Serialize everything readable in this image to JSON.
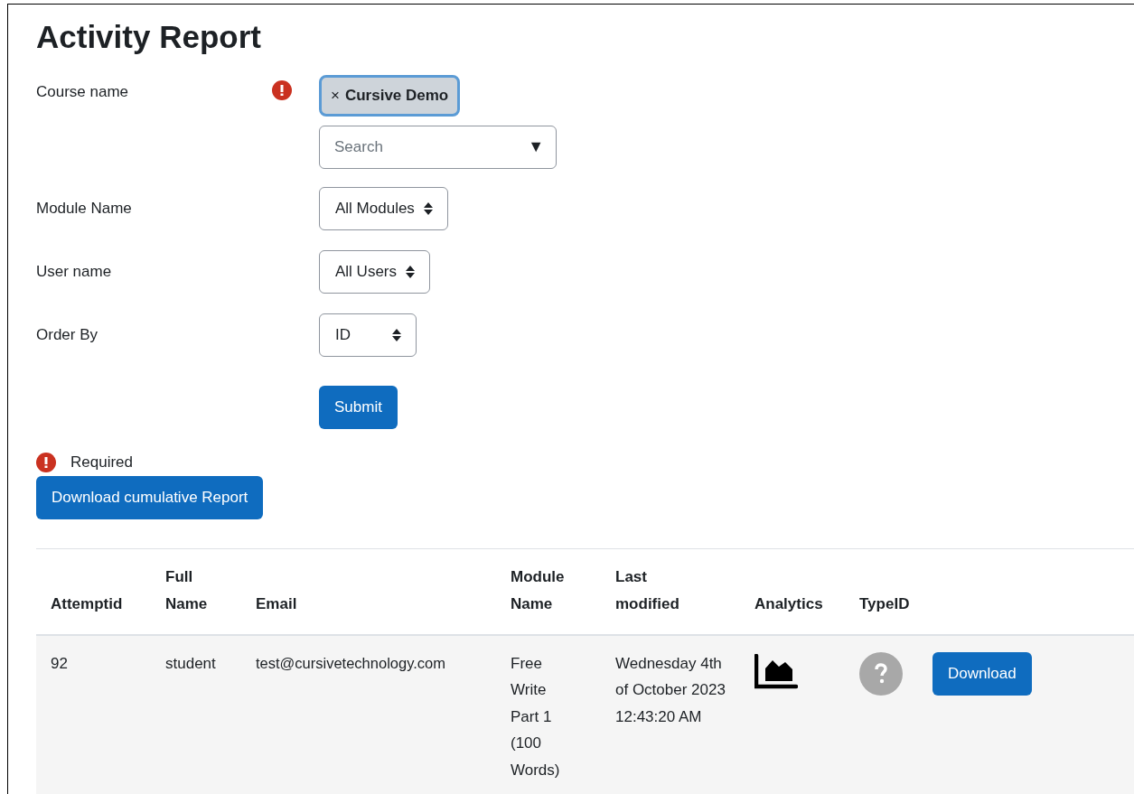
{
  "title": "Activity Report",
  "form": [
    {
      "kind": "autocomplete",
      "label": "Course name",
      "required": true,
      "chips": [
        "Cursive Demo"
      ],
      "chip_remove": "×",
      "placeholder": "Search",
      "caret": "▼"
    },
    {
      "kind": "select",
      "label": "Module Name",
      "value": "All Modules"
    },
    {
      "kind": "select",
      "label": "User name",
      "value": "All Users"
    },
    {
      "kind": "select",
      "label": "Order By",
      "value": "ID"
    }
  ],
  "submit": "Submit",
  "required_note": "Required",
  "download_cumulative": "Download cumulative Report",
  "table": {
    "columns": [
      "Attemptid",
      "Full Name",
      "Email",
      "Module Name",
      "Last modified",
      "Analytics",
      "TypeID",
      ""
    ],
    "rows": [
      {
        "attemptid": "92",
        "full_name": "student",
        "email": "test@cursivetechnology.com",
        "module_name": "Free Write Part 1 (100 Words)",
        "last_modified": "Wednesday 4th of October 2023 12:43:20 AM",
        "download": "Download"
      }
    ]
  }
}
